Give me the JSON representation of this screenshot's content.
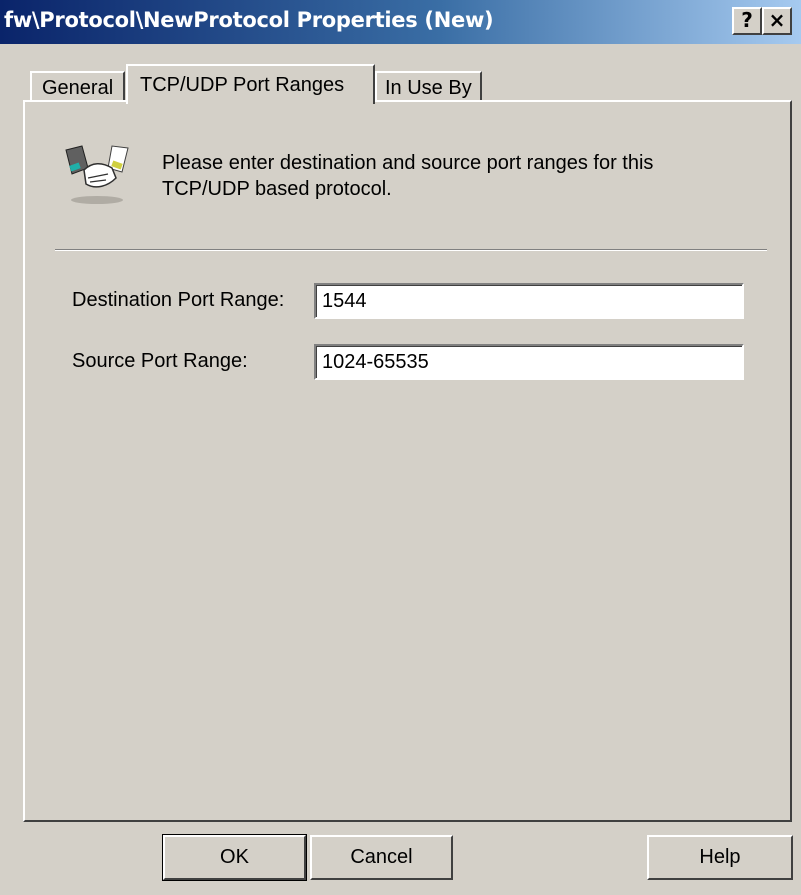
{
  "window": {
    "title": "fw\\Protocol\\NewProtocol Properties (New)",
    "help_glyph": "?",
    "close_glyph": "×"
  },
  "tabs": [
    {
      "label": "General",
      "active": false
    },
    {
      "label": "TCP/UDP Port Ranges",
      "active": true
    },
    {
      "label": "In Use By",
      "active": false
    }
  ],
  "panel": {
    "intro_line1": "Please enter destination and source port ranges for this",
    "intro_line2": "TCP/UDP based protocol.",
    "icon": "handshake-icon",
    "fields": {
      "destination": {
        "label": "Destination Port Range:",
        "value": "1544"
      },
      "source": {
        "label": "Source Port Range:",
        "value": "1024-65535"
      }
    }
  },
  "buttons": {
    "ok": "OK",
    "cancel": "Cancel",
    "help": "Help"
  },
  "colors": {
    "titlebar_start": "#0a246a",
    "titlebar_end": "#a6caf0",
    "face": "#d4d0c8"
  }
}
